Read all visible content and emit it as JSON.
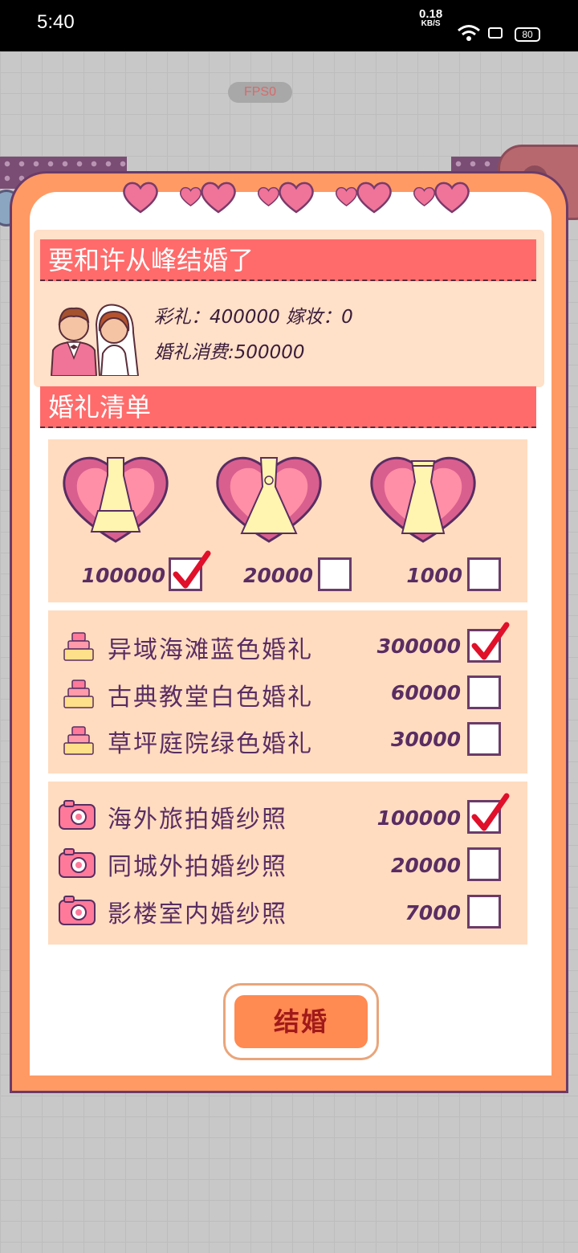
{
  "status_bar": {
    "time": "5:40",
    "net_speed_value": "0.18",
    "net_speed_unit": "KB/S",
    "battery": "80"
  },
  "game": {
    "fps_label": "FPS0"
  },
  "dialog": {
    "title": "要和许从峰结婚了",
    "bride_price_label": "彩礼：",
    "bride_price_value": "400000",
    "dowry_label": "嫁妆：",
    "dowry_value": "0",
    "wedding_cost_label": "婚礼消费:",
    "wedding_cost_value": "500000",
    "list_title": "婚礼清单",
    "dresses": [
      {
        "price": "100000",
        "checked": true
      },
      {
        "price": "20000",
        "checked": false
      },
      {
        "price": "1000",
        "checked": false
      }
    ],
    "ceremonies": [
      {
        "label": "异域海滩蓝色婚礼",
        "price": "300000",
        "checked": true
      },
      {
        "label": "古典教堂白色婚礼",
        "price": "60000",
        "checked": false
      },
      {
        "label": "草坪庭院绿色婚礼",
        "price": "30000",
        "checked": false
      }
    ],
    "photos": [
      {
        "label": "海外旅拍婚纱照",
        "price": "100000",
        "checked": true
      },
      {
        "label": "同城外拍婚纱照",
        "price": "20000",
        "checked": false
      },
      {
        "label": "影楼室内婚纱照",
        "price": "7000",
        "checked": false
      }
    ],
    "confirm_button": "结婚"
  },
  "colors": {
    "dialog_border": "#ff9a64",
    "banner": "#ff6b6b",
    "panel": "#ffdcc0",
    "text_purple": "#5a2d62",
    "check_red": "#e0102a"
  },
  "icons": [
    "heart-icon",
    "couple-icon",
    "wedding-dress-icon",
    "cake-icon",
    "camera-icon",
    "checkmark-icon"
  ]
}
